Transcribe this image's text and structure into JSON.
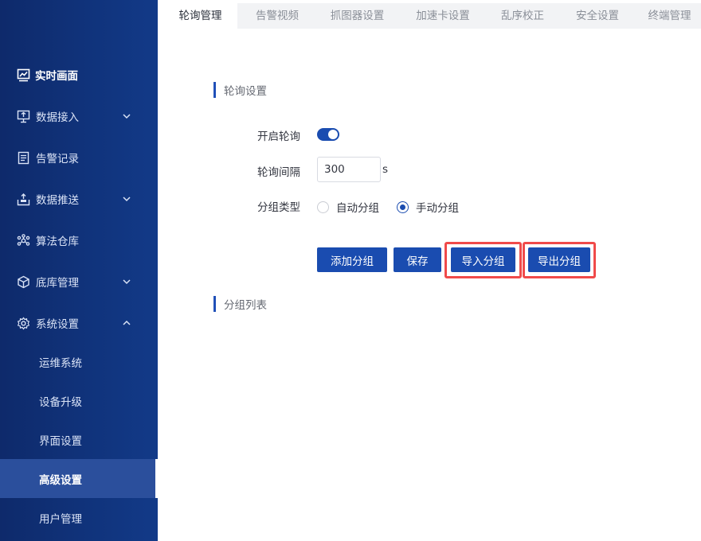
{
  "sidebar": {
    "items": [
      {
        "label": "实时画面",
        "icon": "monitor-chart-icon"
      },
      {
        "label": "数据接入",
        "icon": "screen-upload-icon"
      },
      {
        "label": "告警记录",
        "icon": "document-list-icon"
      },
      {
        "label": "数据推送",
        "icon": "tray-upload-icon"
      },
      {
        "label": "算法仓库",
        "icon": "nodes-icon"
      },
      {
        "label": "底库管理",
        "icon": "cube-icon"
      },
      {
        "label": "系统设置",
        "icon": "gear-icon"
      }
    ],
    "sub_items": [
      {
        "label": "运维系统"
      },
      {
        "label": "设备升级"
      },
      {
        "label": "界面设置"
      },
      {
        "label": "高级设置"
      },
      {
        "label": "用户管理"
      }
    ]
  },
  "tabs": [
    "轮询管理",
    "告警视频",
    "抓图器设置",
    "加速卡设置",
    "乱序校正",
    "安全设置",
    "终端管理"
  ],
  "section1": {
    "title": "轮询设置"
  },
  "form": {
    "toggle_label": "开启轮询",
    "interval_label": "轮询间隔",
    "interval_value": "300",
    "interval_unit": "s",
    "group_type_label": "分组类型",
    "radio_auto": "自动分组",
    "radio_manual": "手动分组"
  },
  "buttons": {
    "add": "添加分组",
    "save": "保存",
    "import": "导入分组",
    "export": "导出分组"
  },
  "section2": {
    "title": "分组列表"
  },
  "colors": {
    "sidebar": "#0e2a6b",
    "primary": "#1a4cb0",
    "highlight": "#f04a4a"
  }
}
